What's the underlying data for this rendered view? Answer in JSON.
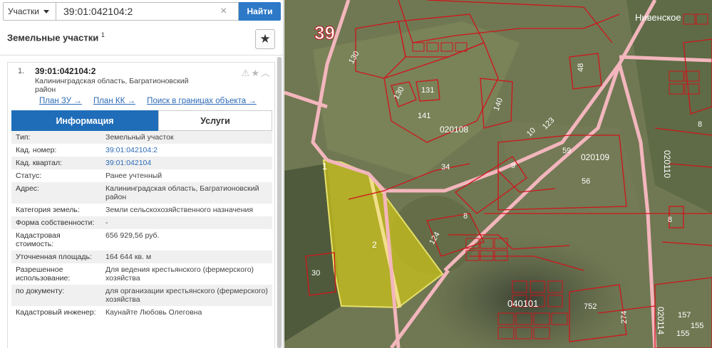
{
  "search": {
    "type_label": "Участки",
    "query": "39:01:042104:2",
    "find_label": "Найти"
  },
  "panel": {
    "title": "Земельные участки",
    "title_sup": "1"
  },
  "item": {
    "number": "1.",
    "cadnum": "39:01:042104:2",
    "address": "Калининградская область, Багратионовский район",
    "links": [
      "План ЗУ →",
      "План КК →",
      "Поиск в границах объекта →"
    ]
  },
  "tabs": {
    "info": "Информация",
    "services": "Услуги"
  },
  "info_rows": [
    {
      "k": "Тип:",
      "v": "Земельный участок"
    },
    {
      "k": "Кад. номер:",
      "v": "39:01:042104:2"
    },
    {
      "k": "Кад. квартал:",
      "v": "39:01:042104"
    },
    {
      "k": "Статус:",
      "v": "Ранее учтенный"
    },
    {
      "k": "Адрес:",
      "v": "Калининградская область, Багратионовский район"
    },
    {
      "k": "Категория земель:",
      "v": "Земли сельскохозяйственного назначения"
    },
    {
      "k": "Форма собственности:",
      "v": "-"
    },
    {
      "k": "Кадастровая стоимость:",
      "v": "656 929,56 руб."
    },
    {
      "k": "Уточненная площадь:",
      "v": "164 644 кв. м"
    },
    {
      "k": "Разрешенное использование:",
      "v": "Для ведения крестьянского (фермерского) хозяйства"
    },
    {
      "k": "по документу:",
      "v": "для организации крестьянского (фермерского) хозяйства"
    },
    {
      "k": "Кадастровый инженер:",
      "v": "Каунайте Любовь Олеговна"
    }
  ],
  "map": {
    "region_label": "39",
    "place_label": "Нивенское",
    "parcel_labels": [
      "130",
      "130",
      "131",
      "141",
      "140",
      "48",
      "020108",
      "10",
      "123",
      "59",
      "020109",
      "56",
      "34",
      "9",
      "8",
      "124",
      "1",
      "2",
      "30",
      "040101",
      "752",
      "274",
      "020110",
      "020114",
      "157",
      "155",
      "155",
      "8",
      "8"
    ]
  },
  "colors": {
    "accent": "#2d79c7",
    "tab_active": "#1f6db9",
    "link": "#2d6ab6",
    "parcel_border": "#d0141c",
    "road": "#f3b6bd",
    "selection_fill": "#c9c21a"
  }
}
